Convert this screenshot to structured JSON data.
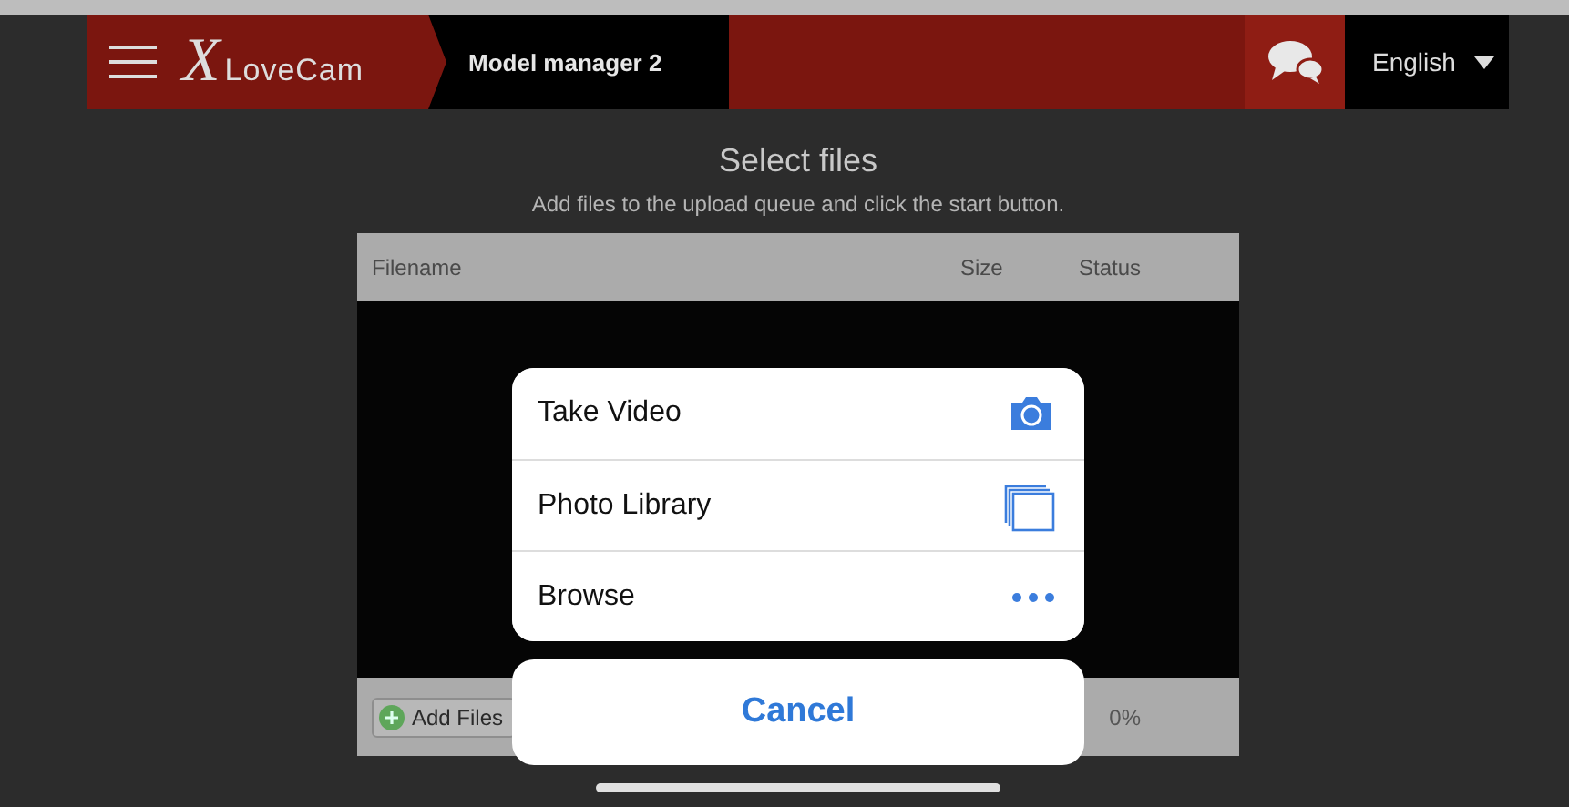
{
  "header": {
    "logo": "LoveCam",
    "logo_initial": "X",
    "title": "Model manager 2",
    "language": "English"
  },
  "uploader": {
    "title": "Select files",
    "subtitle": "Add files to the upload queue and click the start button.",
    "columns": [
      "Filename",
      "Size",
      "Status"
    ],
    "add_button": "Add Files",
    "progress": "0%"
  },
  "action_sheet": {
    "actions": [
      {
        "label": "Take Video",
        "kind": "camera"
      },
      {
        "label": "Photo Library",
        "kind": "library"
      },
      {
        "label": "Browse",
        "kind": "more"
      }
    ],
    "cancel": "Cancel"
  }
}
